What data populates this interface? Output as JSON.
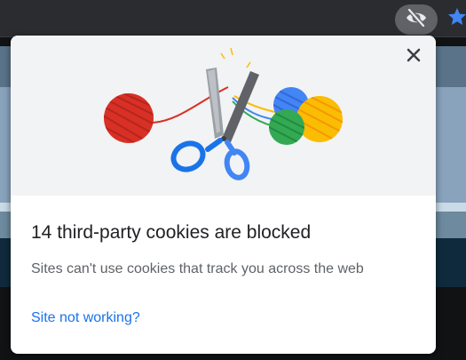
{
  "toolbar": {
    "tracking_icon": "eye-slash-icon",
    "bookmark_icon": "star-icon",
    "bookmark_color": "#4285f4"
  },
  "popup": {
    "close_icon": "close-icon",
    "illustration": "yarn-balls-and-scissors-illustration",
    "title": "14 third-party cookies are blocked",
    "subtitle": "Sites can't use cookies that track you across the web",
    "link": "Site not working?",
    "colors": {
      "red": "#d93025",
      "blue": "#4285f4",
      "green": "#34a853",
      "yellow": "#fbbc04",
      "link": "#1a73e8"
    }
  }
}
